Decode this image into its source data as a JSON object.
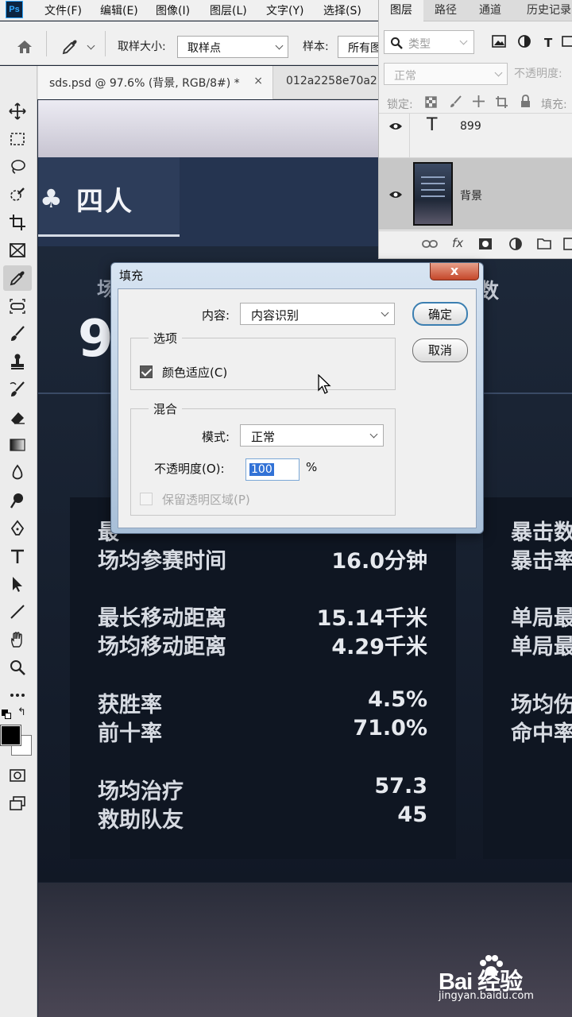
{
  "app": {
    "logo_text": "Ps"
  },
  "menu": [
    "文件(F)",
    "编辑(E)",
    "图像(I)",
    "图层(L)",
    "文字(Y)",
    "选择(S)"
  ],
  "options_bar": {
    "sample_size_label": "取样大小:",
    "sample_size_value": "取样点",
    "sample_label": "样本:",
    "sample_value": "所有图"
  },
  "document_tabs": [
    {
      "label": "sds.psd @ 97.6% (背景, RGB/8#) *",
      "close": "×",
      "active": true
    },
    {
      "label": "012a2258e70a2",
      "active": false
    }
  ],
  "tools": [
    "move-icon",
    "marquee-icon",
    "lasso-icon",
    "quick-select-icon",
    "crop-icon",
    "frame-icon",
    "eyedropper-icon",
    "healing-icon",
    "brush-icon",
    "stamp-icon",
    "history-brush-icon",
    "eraser-icon",
    "gradient-icon",
    "blur-icon",
    "dodge-icon",
    "pen-icon",
    "type-icon",
    "path-select-icon",
    "line-icon",
    "hand-icon",
    "zoom-icon",
    "more-icon"
  ],
  "canvas": {
    "mode_label": "四人",
    "bg_char_1": "场",
    "bg_char_2": "数",
    "big_digit": "9",
    "stat_groups": [
      {
        "rows": [
          {
            "label": "最",
            "value": ""
          },
          {
            "label": "场均参赛时间",
            "value": "16.0分钟"
          }
        ]
      },
      {
        "rows": [
          {
            "label": "最长移动距离",
            "value": "15.14千米"
          },
          {
            "label": "场均移动距离",
            "value": "4.29千米"
          }
        ]
      },
      {
        "rows": [
          {
            "label": "获胜率",
            "value": "4.5%"
          },
          {
            "label": "前十率",
            "value": "71.0%"
          }
        ]
      },
      {
        "rows": [
          {
            "label": "场均治疗",
            "value": "57.3"
          },
          {
            "label": "救助队友",
            "value": "45"
          }
        ]
      }
    ],
    "right_column": [
      "暴击数",
      "暴击率",
      "单局最",
      "单局最",
      "场均伤",
      "命中率"
    ]
  },
  "layers_panel": {
    "tabs": [
      "图层",
      "路径",
      "通道",
      "历史记录"
    ],
    "filter_label": "类型",
    "blend_mode": "正常",
    "opacity_label": "不透明度:",
    "lock_label": "锁定:",
    "fill_label": "填充:",
    "layers": [
      {
        "name": "899",
        "kind": "type",
        "thumb": "T"
      },
      {
        "name": "背景",
        "kind": "image"
      }
    ]
  },
  "fill_dialog": {
    "title": "填充",
    "close": "x",
    "content_label": "内容:",
    "content_value": "内容识别",
    "ok_label": "确定",
    "cancel_label": "取消",
    "options_title": "选项",
    "color_adapt_label": "颜色适应(C)",
    "color_adapt_checked": true,
    "blend_title": "混合",
    "mode_label": "模式:",
    "mode_value": "正常",
    "opacity_label": "不透明度(O):",
    "opacity_value": "100",
    "opacity_unit": "%",
    "preserve_label": "保留透明区域(P)",
    "preserve_checked": false
  },
  "watermark": {
    "brand": "Bai 经验",
    "url": "jingyan.baidu.com"
  },
  "colors": {
    "ps_blue": "#31a8ff",
    "dialog_frame": "#a8bfd8",
    "selection": "#3272d6"
  }
}
